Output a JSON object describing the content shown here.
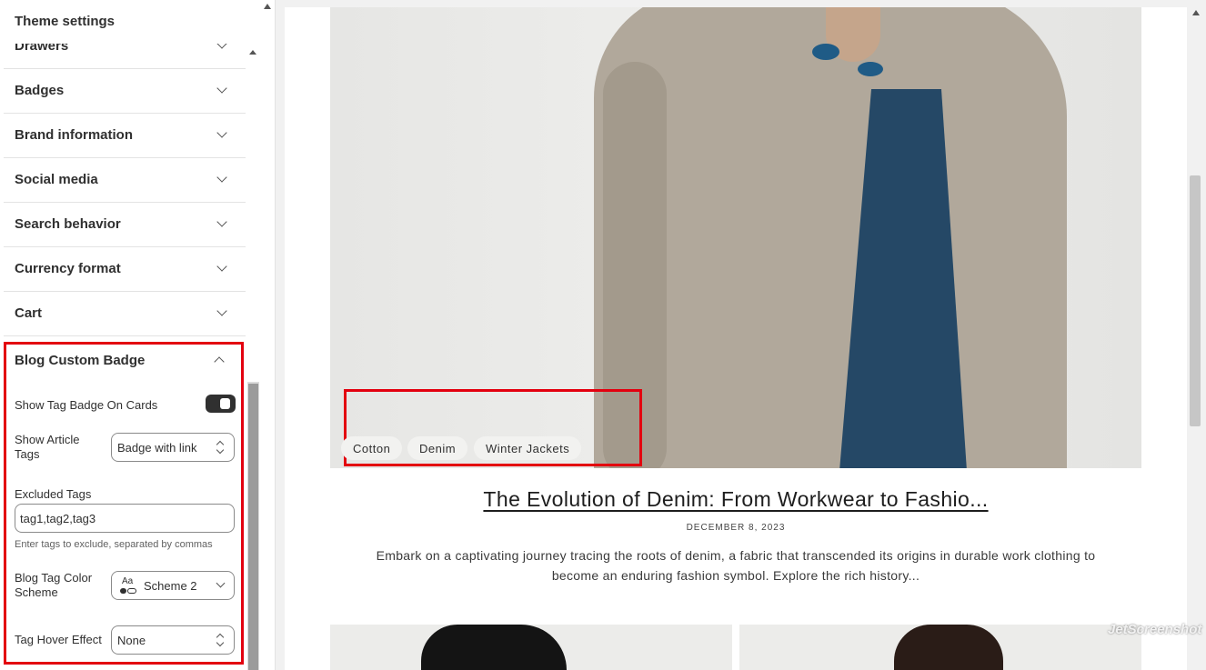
{
  "sidebar": {
    "title": "Theme settings",
    "items": [
      {
        "label": "Drawers"
      },
      {
        "label": "Badges"
      },
      {
        "label": "Brand information"
      },
      {
        "label": "Social media"
      },
      {
        "label": "Search behavior"
      },
      {
        "label": "Currency format"
      },
      {
        "label": "Cart"
      }
    ],
    "section": {
      "title": "Blog Custom Badge",
      "show_tag_badge_label": "Show Tag Badge On Cards",
      "show_tag_badge_on": true,
      "show_article_tags_label": "Show Article Tags",
      "show_article_tags_value": "Badge with link",
      "excluded_tags_label": "Excluded Tags",
      "excluded_tags_value": "tag1,tag2,tag3",
      "excluded_tags_help": "Enter tags to exclude, separated by commas",
      "color_scheme_label": "Blog Tag Color Scheme",
      "color_scheme_value": "Scheme 2",
      "color_scheme_icon_text": "Aa",
      "hover_effect_label": "Tag Hover Effect",
      "hover_effect_value": "None"
    }
  },
  "preview": {
    "tags": [
      "Cotton",
      "Denim",
      "Winter Jackets"
    ],
    "post_title": "The Evolution of Denim: From Workwear to Fashio...",
    "post_date": "DECEMBER 8, 2023",
    "post_excerpt": "Embark on a captivating journey tracing the roots of denim, a fabric that transcended its origins in durable work clothing to become an enduring fashion symbol. Explore the rich history..."
  },
  "watermark": "JetScreenshot",
  "colors": {
    "highlight": "#e3000f",
    "toggle_on": "#303030",
    "shirt": "#254866",
    "coat": "#b1a89b"
  }
}
